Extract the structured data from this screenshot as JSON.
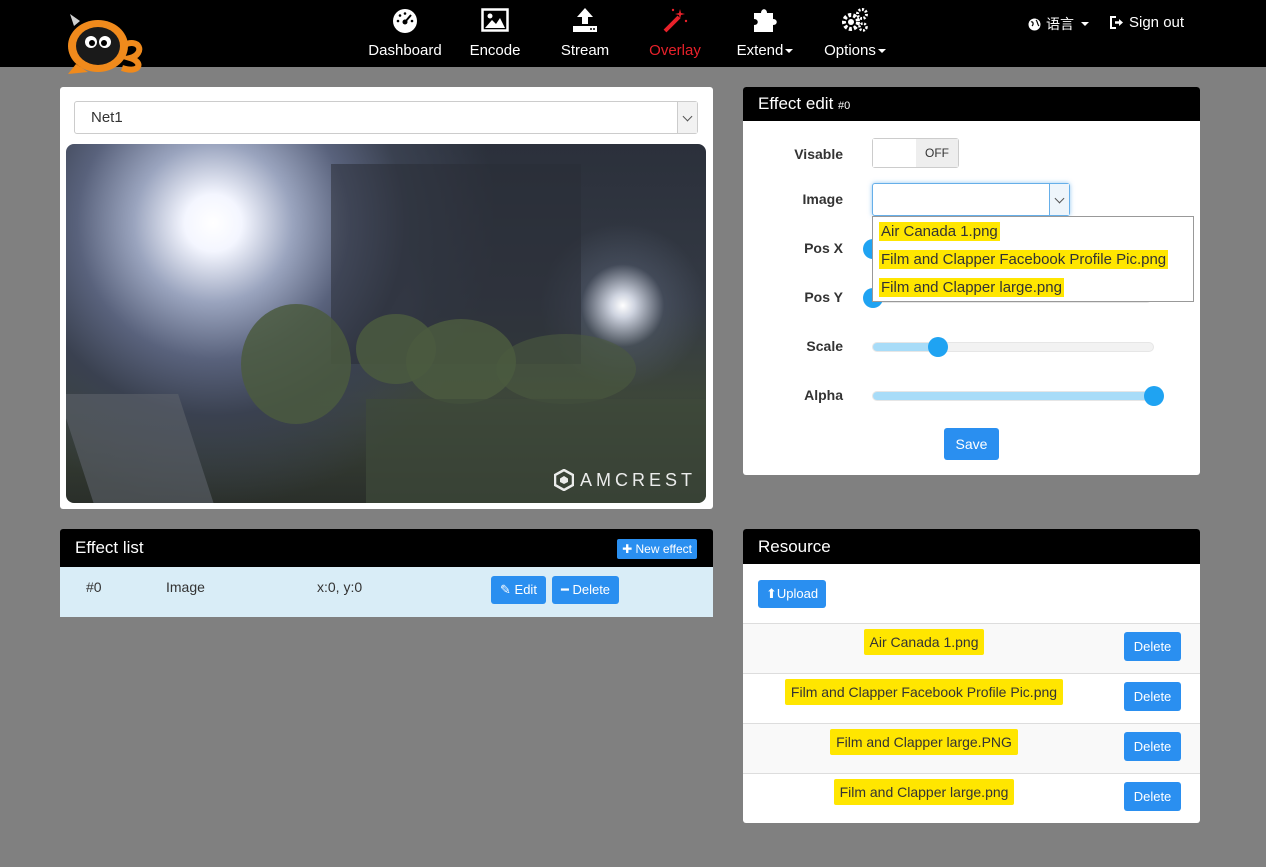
{
  "nav": {
    "items": [
      {
        "label": "Dashboard",
        "icon": "dashboard-gauge-icon"
      },
      {
        "label": "Encode",
        "icon": "image-icon"
      },
      {
        "label": "Stream",
        "icon": "upload-icon"
      },
      {
        "label": "Overlay",
        "icon": "magic-wand-icon"
      },
      {
        "label": "Extend",
        "icon": "puzzle-icon"
      },
      {
        "label": "Options",
        "icon": "gears-icon"
      }
    ],
    "active": "Overlay",
    "language_label": "语言",
    "signout_label": "Sign out"
  },
  "video": {
    "source_select": "Net1",
    "watermark": "AMCREST"
  },
  "effect_edit": {
    "title": "Effect edit",
    "id_tag": "#0",
    "visible_label": "Visable",
    "visible_state": "OFF",
    "image_label": "Image",
    "image_value": "",
    "image_options": [
      "Air Canada 1.png",
      "Film and Clapper Facebook Profile Pic.png",
      "Film and Clapper large.png"
    ],
    "posx_label": "Pos X",
    "posy_label": "Pos Y",
    "scale_label": "Scale",
    "scale_value_fraction": 0.23,
    "alpha_label": "Alpha",
    "alpha_value_fraction": 1.0,
    "save_label": "Save"
  },
  "effect_list": {
    "title": "Effect list",
    "new_button": "New effect",
    "rows": [
      {
        "id": "#0",
        "type": "Image",
        "pos": "x:0, y:0",
        "edit": "Edit",
        "delete": "Delete"
      }
    ]
  },
  "resource": {
    "title": "Resource",
    "upload_label": "Upload",
    "files": [
      {
        "name": "Air Canada 1.png",
        "delete": "Delete"
      },
      {
        "name": "Film and Clapper Facebook Profile Pic.png",
        "delete": "Delete"
      },
      {
        "name": "Film and Clapper large.PNG",
        "delete": "Delete"
      },
      {
        "name": "Film and Clapper large.png",
        "delete": "Delete"
      }
    ]
  },
  "colors": {
    "navbar": "#000000",
    "background": "#808080",
    "accent_blue": "#2a8ff0",
    "active_nav": "#e8212a",
    "highlight": "#ffe600"
  }
}
